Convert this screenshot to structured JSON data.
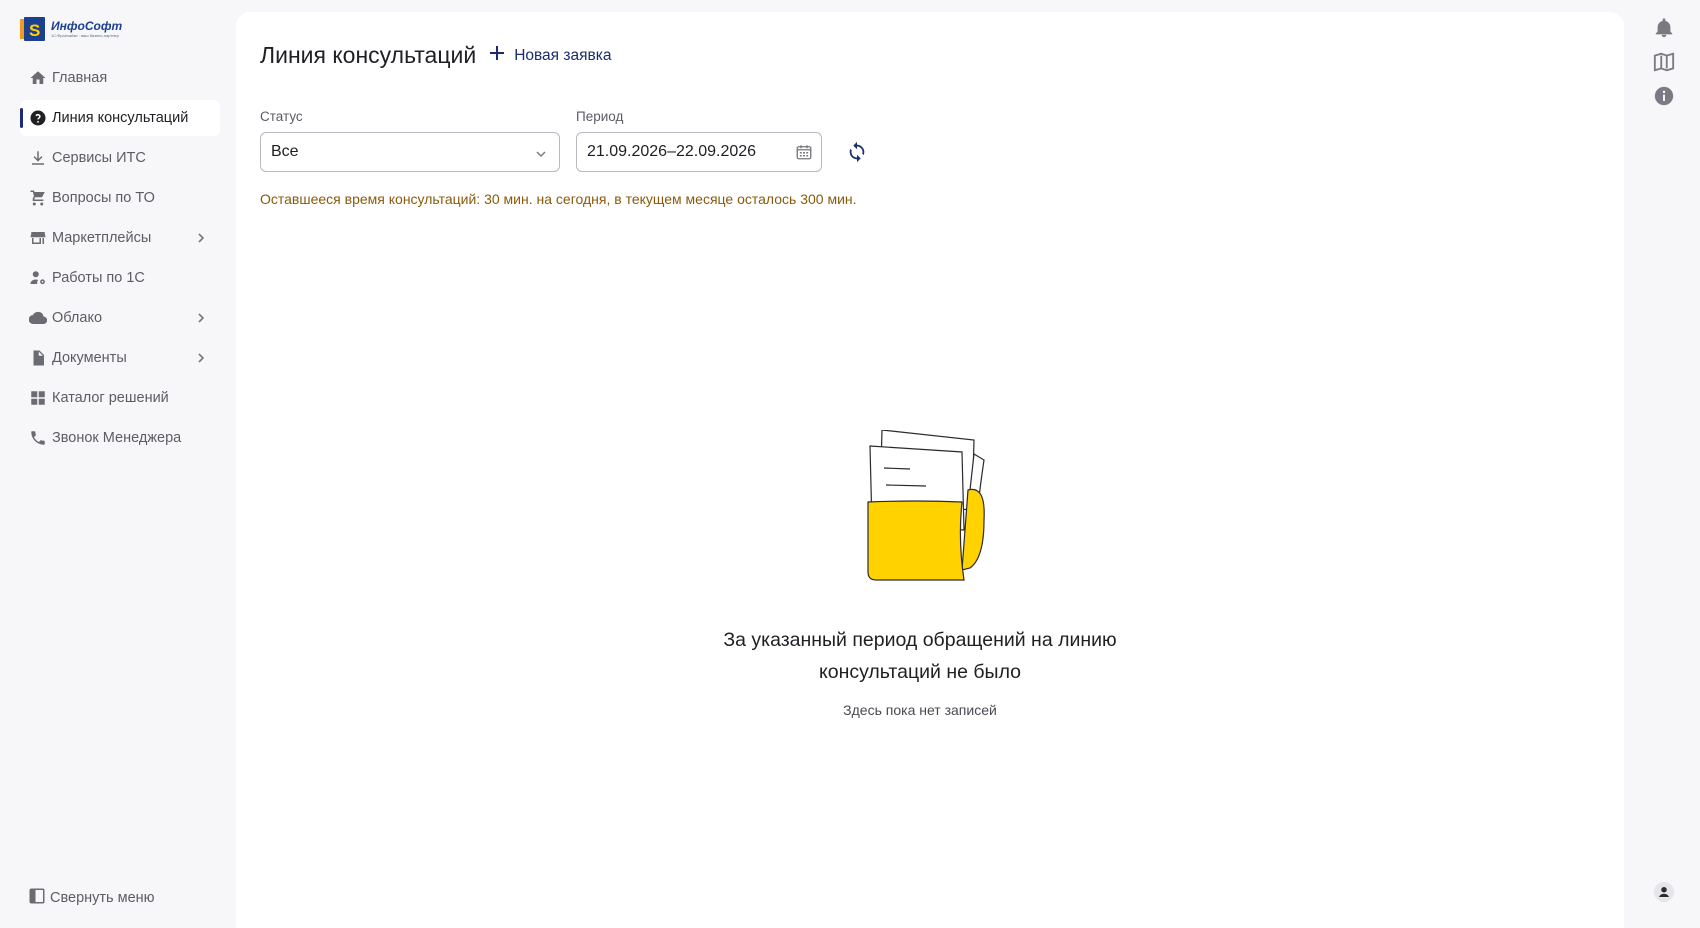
{
  "logo": {
    "name": "ИнфоСофт",
    "tagline": "1С:Франчайзи · ваш бизнес-партнер"
  },
  "sidebar": {
    "items": [
      {
        "label": "Главная",
        "icon": "home-icon"
      },
      {
        "label": "Линия консультаций",
        "icon": "help-circle-icon",
        "active": true
      },
      {
        "label": "Сервисы ИТС",
        "icon": "download-icon"
      },
      {
        "label": "Вопросы по ТО",
        "icon": "cart-icon"
      },
      {
        "label": "Маркетплейсы",
        "icon": "store-icon",
        "expandable": true
      },
      {
        "label": "Работы по 1С",
        "icon": "user-gear-icon"
      },
      {
        "label": "Облако",
        "icon": "cloud-icon",
        "expandable": true
      },
      {
        "label": "Документы",
        "icon": "document-icon",
        "expandable": true
      },
      {
        "label": "Каталог решений",
        "icon": "grid-icon"
      },
      {
        "label": "Звонок Менеджера",
        "icon": "phone-icon"
      }
    ],
    "collapse_label": "Свернуть меню"
  },
  "header": {
    "title": "Линия консультаций",
    "new_request_label": "Новая заявка"
  },
  "filters": {
    "status_label": "Статус",
    "status_value": "Все",
    "period_label": "Период",
    "period_value": "21.09.2026–22.09.2026"
  },
  "notice": "Оставшееся время консультаций: 30 мин. на сегодня, в текущем месяце осталось 300 мин.",
  "empty_state": {
    "title": "За указанный период обращений на линию консультаций не было",
    "subtitle": "Здесь пока нет записей"
  },
  "colors": {
    "accent": "#1c2c6e",
    "notice": "#8a5a0b",
    "folder": "#ffd200",
    "background": "#f7f7f9"
  }
}
